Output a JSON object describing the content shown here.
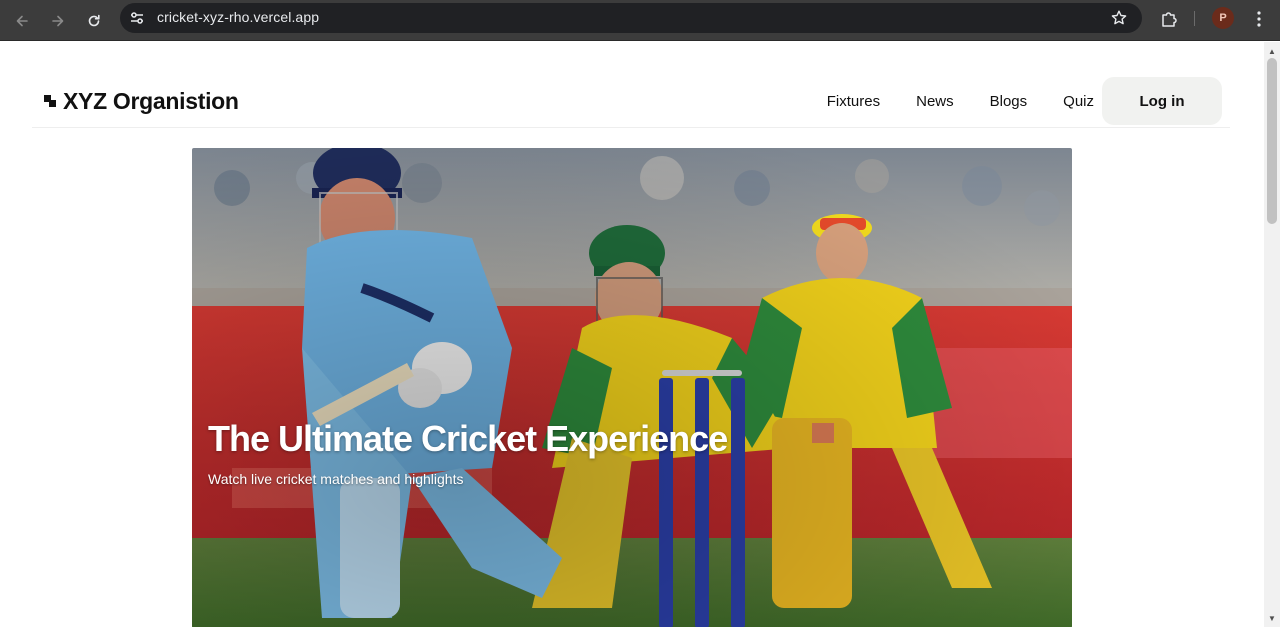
{
  "browser": {
    "url": "cricket-xyz-rho.vercel.app",
    "profile_initial": "P",
    "icons": {
      "back": "arrow-left-icon",
      "forward": "arrow-right-icon",
      "reload": "reload-icon",
      "site_info": "tune-icon",
      "bookmark": "star-icon",
      "extensions": "puzzle-icon",
      "menu": "kebab-menu-icon"
    }
  },
  "header": {
    "logo_text": "XYZ Organistion",
    "nav": [
      "Fixtures",
      "News",
      "Blogs",
      "Quiz"
    ],
    "login_label": "Log in"
  },
  "hero": {
    "title": "The Ultimate Cricket Experience",
    "subtitle": "Watch live cricket matches and highlights",
    "image_alt": "cricket-match-photo",
    "colors": {
      "england_kit": "#6fb3e3",
      "australia_kit": "#f2d21b",
      "australia_green": "#2e8b3c",
      "advertising_board": "#d42d2b",
      "stumps": "#2b3fa8"
    }
  }
}
